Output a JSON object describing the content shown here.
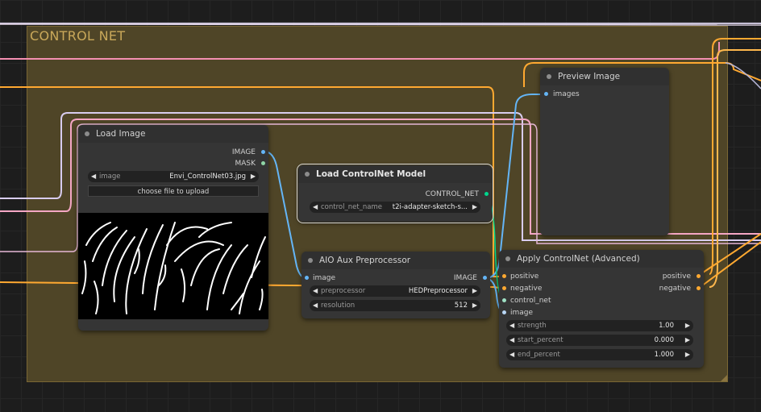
{
  "group": {
    "title": "CONTROL NET"
  },
  "colors": {
    "group_bg": "#4f4527",
    "wire_image": "#64b5f6",
    "wire_conditioning": "#ffa931",
    "wire_model": "#b39ddb",
    "wire_clip": "#ffd500",
    "wire_pink": "#f48fb1",
    "wire_controlnet": "#00d78d"
  },
  "load_image": {
    "title": "Load Image",
    "outputs": [
      "IMAGE",
      "MASK"
    ],
    "image_widget": {
      "name": "image",
      "value": "Envi_ControlNet03.jpg"
    },
    "upload_button": "choose file to upload"
  },
  "load_controlnet": {
    "title": "Load ControlNet Model",
    "output": "CONTROL_NET",
    "widget": {
      "name": "control_net_name",
      "value": "t2i-adapter-sketch-s..."
    }
  },
  "aio_preprocessor": {
    "title": "AIO Aux Preprocessor",
    "input": "image",
    "output": "IMAGE",
    "widgets": [
      {
        "name": "preprocessor",
        "value": "HEDPreprocessor"
      },
      {
        "name": "resolution",
        "value": "512"
      }
    ]
  },
  "preview_image": {
    "title": "Preview Image",
    "input": "images"
  },
  "apply_controlnet": {
    "title": "Apply ControlNet (Advanced)",
    "inputs": [
      "positive",
      "negative",
      "control_net",
      "image"
    ],
    "outputs": [
      "positive",
      "negative"
    ],
    "widgets": [
      {
        "name": "strength",
        "value": "1.00"
      },
      {
        "name": "start_percent",
        "value": "0.000"
      },
      {
        "name": "end_percent",
        "value": "1.000"
      }
    ]
  },
  "icons": {
    "arrow_left": "◀",
    "arrow_right": "▶"
  }
}
